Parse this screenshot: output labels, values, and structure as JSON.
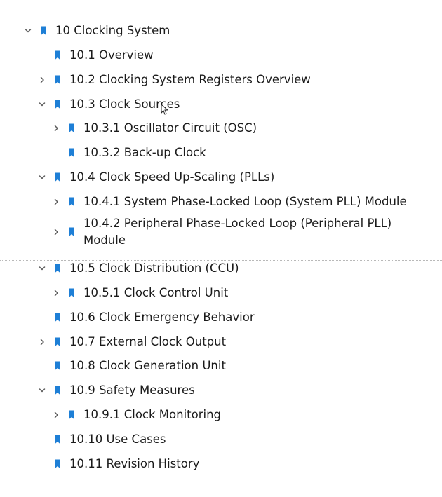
{
  "colors": {
    "bookmark": "#1e7fd6",
    "chevron": "#5b5b5b",
    "text": "#1b1b1b"
  },
  "icons": {
    "bookmark": "bookmark-icon",
    "expanded": "chevron-down-icon",
    "collapsed": "chevron-right-icon"
  },
  "outline": [
    {
      "label": "10 Clocking System",
      "level": 0,
      "toggle": "expanded"
    },
    {
      "label": "10.1 Overview",
      "level": 1,
      "toggle": "none"
    },
    {
      "label": "10.2 Clocking System Registers Overview",
      "level": 1,
      "toggle": "collapsed"
    },
    {
      "label": "10.3 Clock Sources",
      "level": 1,
      "toggle": "expanded"
    },
    {
      "label": "10.3.1 Oscillator Circuit (OSC)",
      "level": 2,
      "toggle": "collapsed"
    },
    {
      "label": "10.3.2 Back-up Clock",
      "level": 2,
      "toggle": "none"
    },
    {
      "label": "10.4 Clock Speed Up-Scaling (PLLs)",
      "level": 1,
      "toggle": "expanded"
    },
    {
      "label": "10.4.1 System Phase-Locked Loop (System PLL) Module",
      "level": 2,
      "toggle": "collapsed"
    },
    {
      "label": "10.4.2 Peripheral Phase-Locked Loop (Peripheral PLL) Module",
      "level": 2,
      "toggle": "collapsed"
    },
    {
      "label": "10.5 Clock Distribution (CCU)",
      "level": 1,
      "toggle": "expanded"
    },
    {
      "label": "10.5.1 Clock Control Unit",
      "level": 2,
      "toggle": "collapsed"
    },
    {
      "label": "10.6 Clock Emergency Behavior",
      "level": 1,
      "toggle": "none"
    },
    {
      "label": "10.7 External Clock Output",
      "level": 1,
      "toggle": "collapsed"
    },
    {
      "label": "10.8 Clock Generation Unit",
      "level": 1,
      "toggle": "none"
    },
    {
      "label": "10.9 Safety Measures",
      "level": 1,
      "toggle": "expanded"
    },
    {
      "label": "10.9.1 Clock Monitoring",
      "level": 2,
      "toggle": "collapsed"
    },
    {
      "label": "10.10 Use Cases",
      "level": 1,
      "toggle": "none"
    },
    {
      "label": "10.11 Revision History",
      "level": 1,
      "toggle": "none"
    }
  ]
}
